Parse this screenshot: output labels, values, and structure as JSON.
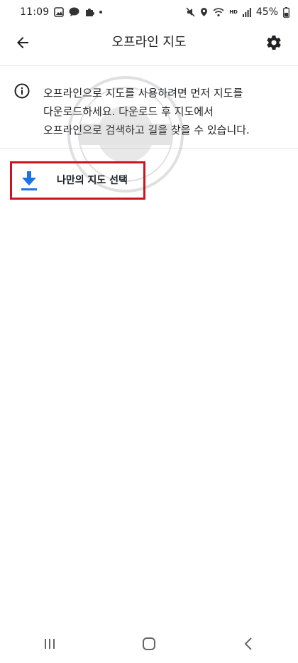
{
  "status_bar": {
    "time": "11:09",
    "battery": "45%",
    "network_badge": "HD",
    "icons": [
      "gallery-icon",
      "talk-icon",
      "puzzle-icon",
      "notification-dot",
      "mute-icon",
      "location-icon",
      "wifi-icon",
      "hd-voice-icon",
      "signal-icon"
    ]
  },
  "app_bar": {
    "title": "오프라인 지도",
    "back_icon": "arrow-left-icon",
    "settings_icon": "gear-icon"
  },
  "info": {
    "icon": "info-icon",
    "line1": "오프라인으로 지도를 사용하려면 먼저 지도를",
    "line2": "다운로드하세요. 다운로드 후 지도에서",
    "line3": "오프라인으로 검색하고 길을 찾을 수 있습니다."
  },
  "select_map": {
    "label": "나만의 지도 선택",
    "icon": "download-icon",
    "highlight_color": "#d0121f",
    "icon_color": "#1a73e8"
  },
  "nav_bar": {
    "icons": [
      "recent-apps-icon",
      "home-icon",
      "back-icon"
    ]
  }
}
